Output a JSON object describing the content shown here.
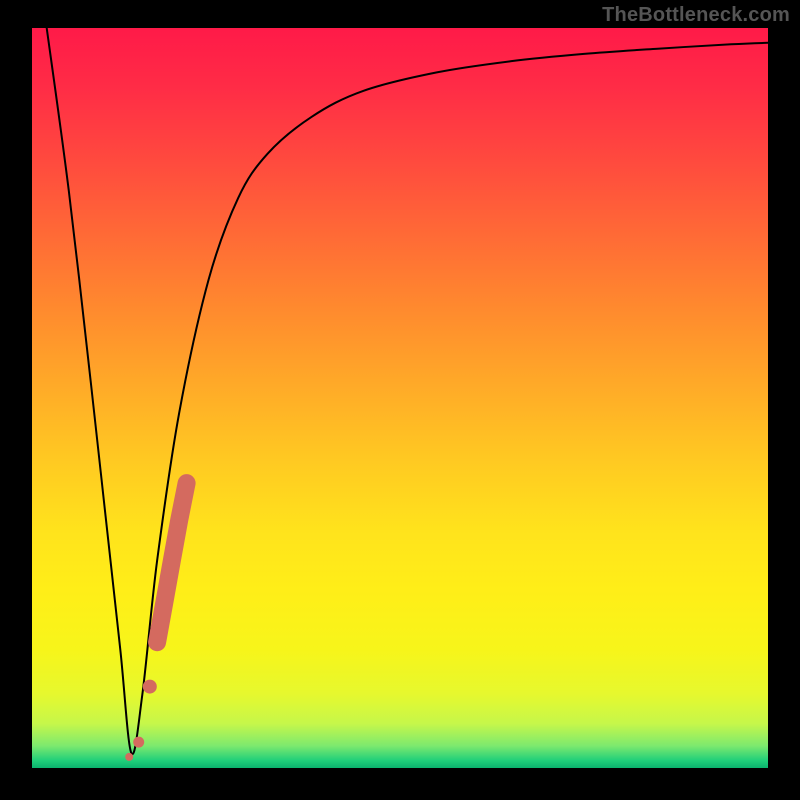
{
  "watermark": "TheBottleneck.com",
  "chart_data": {
    "type": "line",
    "title": "",
    "xlabel": "",
    "ylabel": "",
    "xlim": [
      0,
      100
    ],
    "ylim": [
      0,
      100
    ],
    "grid": false,
    "series": [
      {
        "name": "bottleneck-curve",
        "color": "#000000",
        "x": [
          2,
          5,
          8,
          10,
          12,
          13.5,
          15,
          17,
          20,
          24,
          28,
          32,
          38,
          45,
          55,
          65,
          75,
          85,
          95,
          100
        ],
        "y": [
          100,
          78,
          52,
          34,
          16,
          2,
          10,
          28,
          48,
          66,
          77,
          83,
          88,
          91.5,
          94,
          95.5,
          96.5,
          97.2,
          97.8,
          98
        ]
      }
    ],
    "highlight": {
      "name": "highlight-band",
      "color": "#d46a5f",
      "points": [
        {
          "x": 13.2,
          "y": 1.5
        },
        {
          "x": 14.5,
          "y": 3.5
        },
        {
          "x": 16.0,
          "y": 11.0
        },
        {
          "x": 17.0,
          "y": 17.0
        },
        {
          "x": 18.0,
          "y": 22.5
        },
        {
          "x": 19.0,
          "y": 28.0
        },
        {
          "x": 20.0,
          "y": 33.5
        },
        {
          "x": 21.0,
          "y": 38.5
        }
      ]
    }
  }
}
